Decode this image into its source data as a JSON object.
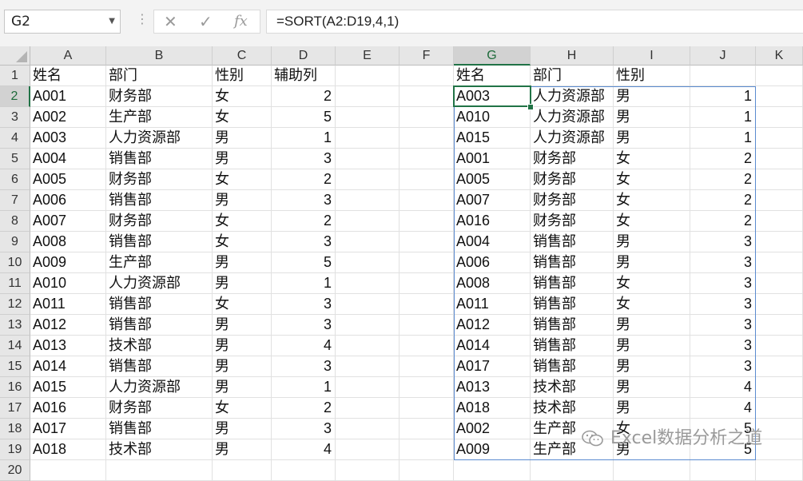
{
  "formula_bar": {
    "name_box": "G2",
    "formula": "=SORT(A2:D19,4,1)",
    "icons": [
      "cancel-icon",
      "enter-icon",
      "function-icon"
    ],
    "cancel_glyph": "✕",
    "enter_glyph": "✓",
    "fx_glyph": "fx"
  },
  "columns": [
    "A",
    "B",
    "C",
    "D",
    "E",
    "F",
    "G",
    "H",
    "I",
    "J",
    "K"
  ],
  "selected_column": "G",
  "selected_row": "2",
  "rows": [
    "1",
    "2",
    "3",
    "4",
    "5",
    "6",
    "7",
    "8",
    "9",
    "10",
    "11",
    "12",
    "13",
    "14",
    "15",
    "16",
    "17",
    "18",
    "19",
    "20"
  ],
  "source_table": {
    "headers": [
      "姓名",
      "部门",
      "性别",
      "辅助列"
    ],
    "rows": [
      [
        "A001",
        "财务部",
        "女",
        "2"
      ],
      [
        "A002",
        "生产部",
        "女",
        "5"
      ],
      [
        "A003",
        "人力资源部",
        "男",
        "1"
      ],
      [
        "A004",
        "销售部",
        "男",
        "3"
      ],
      [
        "A005",
        "财务部",
        "女",
        "2"
      ],
      [
        "A006",
        "销售部",
        "男",
        "3"
      ],
      [
        "A007",
        "财务部",
        "女",
        "2"
      ],
      [
        "A008",
        "销售部",
        "女",
        "3"
      ],
      [
        "A009",
        "生产部",
        "男",
        "5"
      ],
      [
        "A010",
        "人力资源部",
        "男",
        "1"
      ],
      [
        "A011",
        "销售部",
        "女",
        "3"
      ],
      [
        "A012",
        "销售部",
        "男",
        "3"
      ],
      [
        "A013",
        "技术部",
        "男",
        "4"
      ],
      [
        "A014",
        "销售部",
        "男",
        "3"
      ],
      [
        "A015",
        "人力资源部",
        "男",
        "1"
      ],
      [
        "A016",
        "财务部",
        "女",
        "2"
      ],
      [
        "A017",
        "销售部",
        "男",
        "3"
      ],
      [
        "A018",
        "技术部",
        "男",
        "4"
      ]
    ]
  },
  "result_table": {
    "headers": [
      "姓名",
      "部门",
      "性别"
    ],
    "rows": [
      [
        "A003",
        "人力资源部",
        "男",
        "1"
      ],
      [
        "A010",
        "人力资源部",
        "男",
        "1"
      ],
      [
        "A015",
        "人力资源部",
        "男",
        "1"
      ],
      [
        "A001",
        "财务部",
        "女",
        "2"
      ],
      [
        "A005",
        "财务部",
        "女",
        "2"
      ],
      [
        "A007",
        "财务部",
        "女",
        "2"
      ],
      [
        "A016",
        "财务部",
        "女",
        "2"
      ],
      [
        "A004",
        "销售部",
        "男",
        "3"
      ],
      [
        "A006",
        "销售部",
        "男",
        "3"
      ],
      [
        "A008",
        "销售部",
        "女",
        "3"
      ],
      [
        "A011",
        "销售部",
        "女",
        "3"
      ],
      [
        "A012",
        "销售部",
        "男",
        "3"
      ],
      [
        "A014",
        "销售部",
        "男",
        "3"
      ],
      [
        "A017",
        "销售部",
        "男",
        "3"
      ],
      [
        "A013",
        "技术部",
        "男",
        "4"
      ],
      [
        "A018",
        "技术部",
        "男",
        "4"
      ],
      [
        "A002",
        "生产部",
        "女",
        "5"
      ],
      [
        "A009",
        "生产部",
        "男",
        "5"
      ]
    ]
  },
  "watermark": "Excel数据分析之道",
  "colors": {
    "accent": "#217346",
    "spill": "#5b8bd0",
    "header_bg": "#e6e6e6"
  }
}
